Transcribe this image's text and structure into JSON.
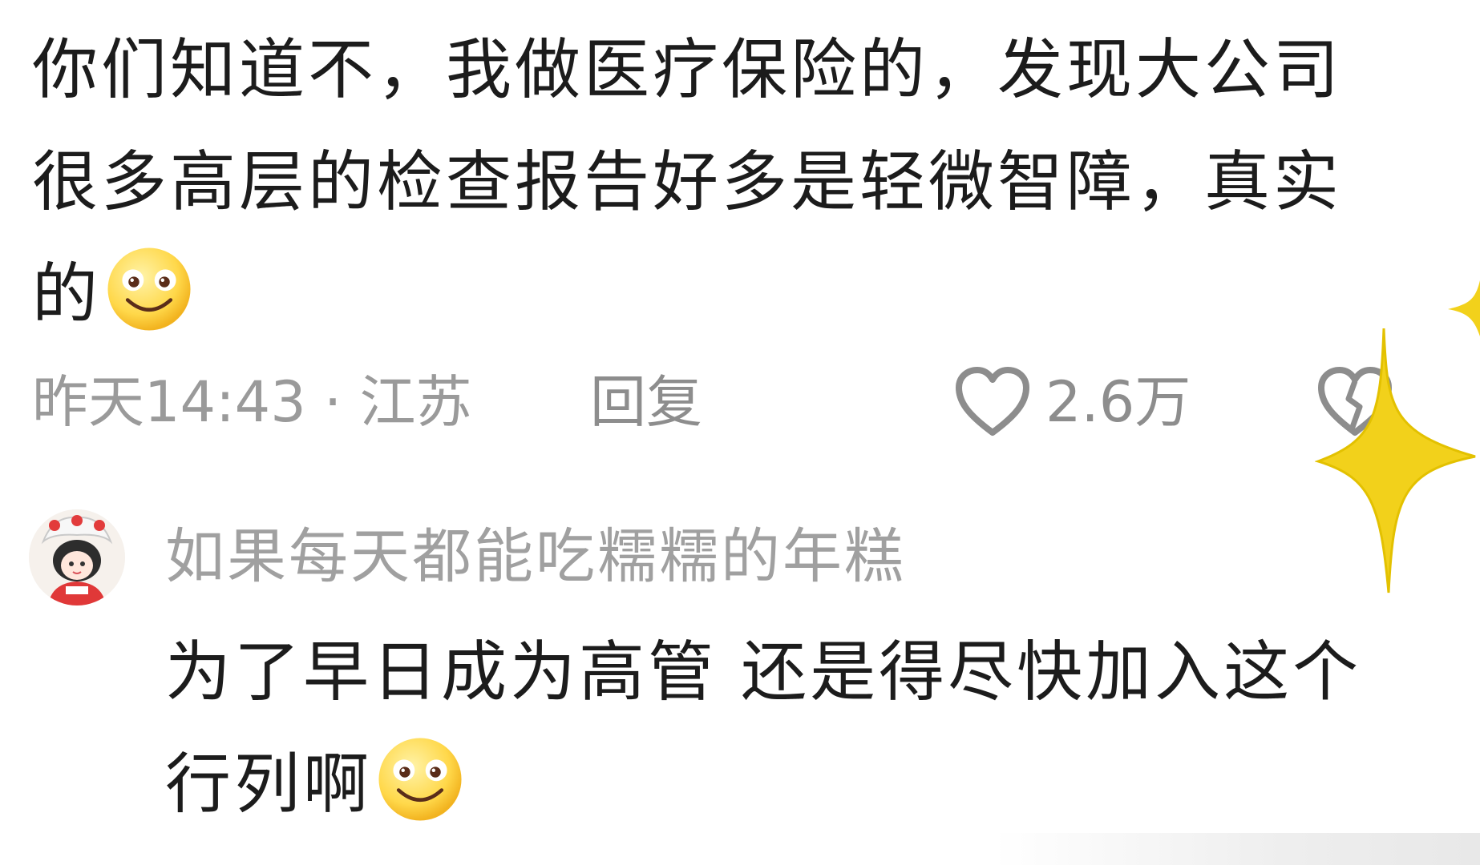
{
  "main_comment": {
    "text": "你们知道不，我做医疗保险的，发现大公司很多高层的检查报告好多是轻微智障，真实的",
    "emoji": "smiley-face-emoji"
  },
  "meta": {
    "time_location": "昨天14:43 · 江苏",
    "reply_label": "回复",
    "like_count": "2.6万",
    "like_icon": "heart-outline-icon",
    "dislike_icon": "broken-heart-icon",
    "accent_sparkle_color": "#f2d11b"
  },
  "reply": {
    "username": "如果每天都能吃糯糯的年糕",
    "text": "为了早日成为高管 还是得尽快加入这个行列啊",
    "emoji": "smiley-face-emoji"
  }
}
